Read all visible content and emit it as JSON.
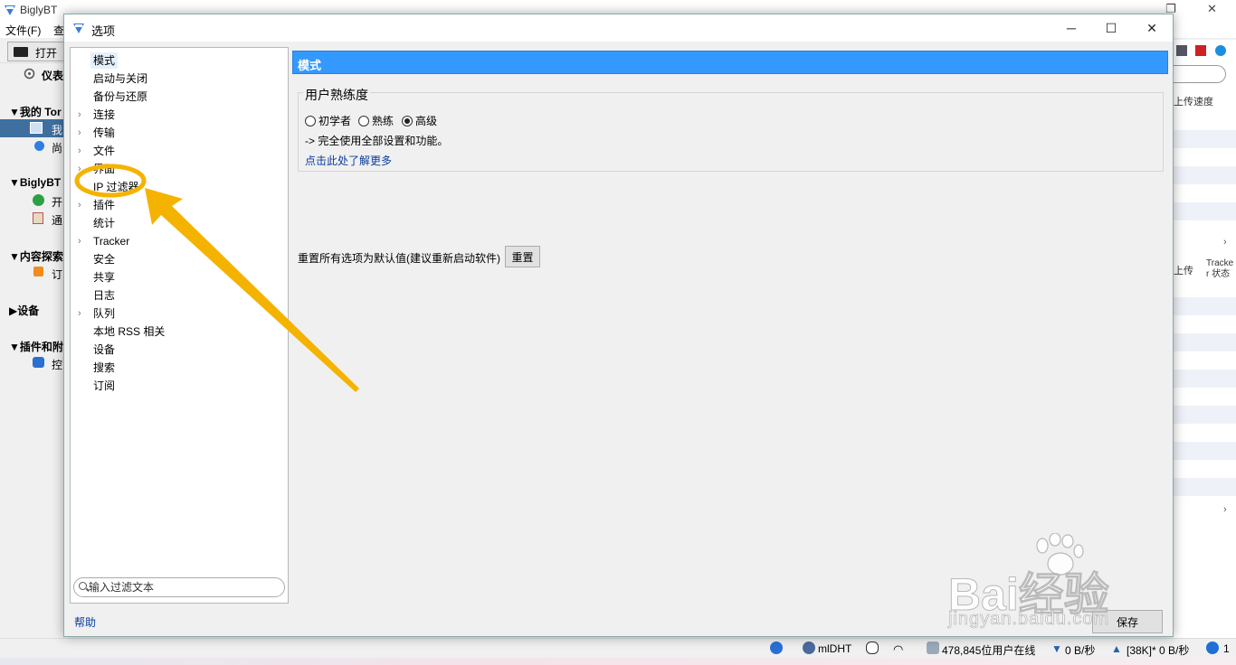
{
  "main_window": {
    "title": "BiglyBT",
    "menu": [
      "文件(F)",
      "查"
    ],
    "toolbar": {
      "open_label": "打开"
    },
    "sidebar": {
      "dashboard": "仪表",
      "section_my_torrents": "▼我的 Tor",
      "item_my": "我",
      "item_unfinished": "尚",
      "section_biglybt": "▼BiglyBT",
      "item_start": "开",
      "item_notify": "通",
      "section_content": "▼内容探索",
      "item_subscribe": "订",
      "section_devices": "▶设备",
      "section_plugins": "▼插件和附",
      "item_console": "控"
    },
    "right_panel": {
      "upload_speed_header": "上传速度",
      "upload_header": "上传",
      "tracker_status_header": "Tracke r 状态"
    },
    "statusbar": {
      "dht": "mlDHT",
      "users_online": "478,845位用户在线",
      "download": "0 B/秒",
      "upload": "[38K]* 0 B/秒",
      "alerts": "1"
    }
  },
  "dialog": {
    "title": "选项",
    "tree": [
      {
        "label": "模式",
        "expandable": false,
        "selected": true
      },
      {
        "label": "启动与关闭",
        "expandable": false
      },
      {
        "label": "备份与还原",
        "expandable": false
      },
      {
        "label": "连接",
        "expandable": true
      },
      {
        "label": "传输",
        "expandable": true
      },
      {
        "label": "文件",
        "expandable": true
      },
      {
        "label": "界面",
        "expandable": true
      },
      {
        "label": "IP 过滤器",
        "expandable": false
      },
      {
        "label": "插件",
        "expandable": true
      },
      {
        "label": "统计",
        "expandable": false
      },
      {
        "label": "Tracker",
        "expandable": true
      },
      {
        "label": "安全",
        "expandable": false
      },
      {
        "label": "共享",
        "expandable": false
      },
      {
        "label": "日志",
        "expandable": false
      },
      {
        "label": "队列",
        "expandable": true
      },
      {
        "label": "本地 RSS 相关",
        "expandable": false
      },
      {
        "label": "设备",
        "expandable": false
      },
      {
        "label": "搜索",
        "expandable": false
      },
      {
        "label": "订阅",
        "expandable": false
      }
    ],
    "filter_placeholder": "输入过滤文本",
    "help_link": "帮助",
    "content": {
      "header": "模式",
      "group_title": "用户熟练度",
      "options": [
        {
          "label": "初学者",
          "checked": false
        },
        {
          "label": "熟练",
          "checked": false
        },
        {
          "label": "高级",
          "checked": true
        }
      ],
      "description": "-> 完全使用全部设置和功能。",
      "learn_more": "点击此处了解更多",
      "reset_label": "重置所有选项为默认值(建议重新启动软件)",
      "reset_button": "重置"
    },
    "save_button": "保存"
  },
  "annotation": {
    "color": "#f5b301"
  },
  "watermark": {
    "brand": "Bai经验",
    "url": "jingyan.baidu.com"
  }
}
